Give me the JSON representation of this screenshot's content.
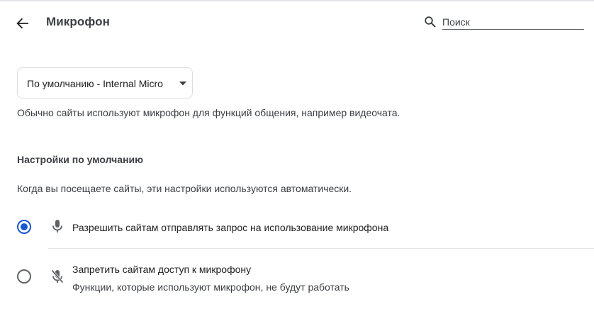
{
  "header": {
    "title": "Микрофон",
    "search_placeholder": "Поиск",
    "search_value": ""
  },
  "device_select": {
    "selected": "По умолчанию - Internal Micro"
  },
  "description": "Обычно сайты используют микрофон для функций общения, например видеочата.",
  "defaults": {
    "heading": "Настройки по умолчанию",
    "description": "Когда вы посещаете сайты, эти настройки используются автоматически.",
    "options": [
      {
        "label": "Разрешить сайтам отправлять запрос на использование микрофона",
        "sublabel": "",
        "selected": true,
        "icon": "mic-icon"
      },
      {
        "label": "Запретить сайтам доступ к микрофону",
        "sublabel": "Функции, которые используют микрофон, не будут работать",
        "selected": false,
        "icon": "mic-off-icon"
      }
    ]
  },
  "colors": {
    "accent": "#1a56cf",
    "text_primary": "#1f1f1f",
    "text_secondary": "#3c4043",
    "icon": "#5f6368",
    "border": "#dadce0"
  }
}
